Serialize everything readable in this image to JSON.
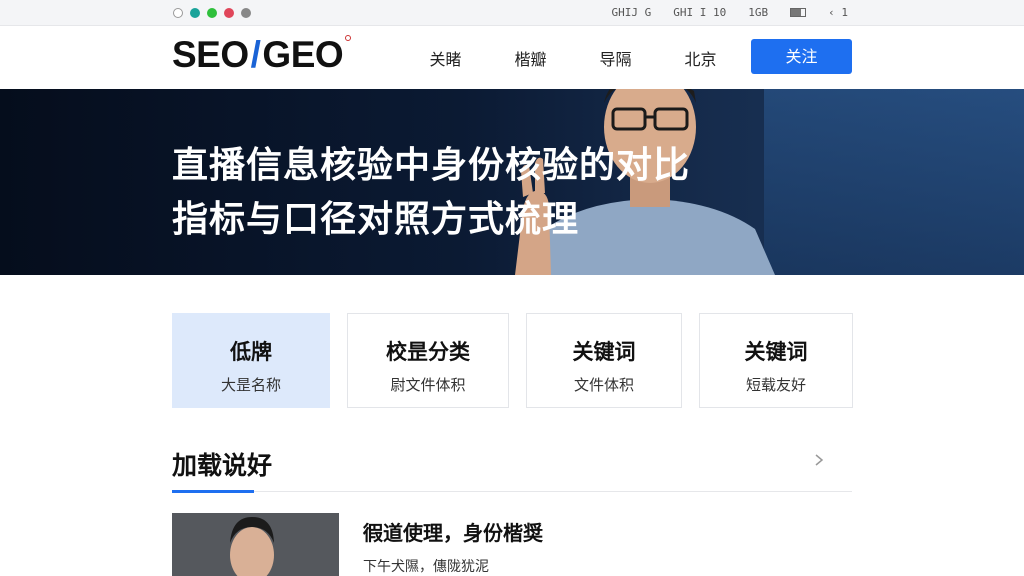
{
  "topbar": {
    "info": [
      "GHIJ G",
      "GHI I 10",
      "1GB",
      "",
      "‹ 1"
    ]
  },
  "header": {
    "logo_left": "SEO",
    "logo_slash": "/",
    "logo_right": "GEO",
    "nav": [
      "关睹",
      "楷瓣",
      "导隔",
      "北京"
    ],
    "follow_label": "关注"
  },
  "hero": {
    "title_line1": "直播信息核验中身份核验的对比",
    "title_line2": "指标与口径对照方式梳理"
  },
  "cards": [
    {
      "title": "低牌",
      "sub": "大昰名称",
      "active": true
    },
    {
      "title": "校昰分类",
      "sub": "尉文件体积",
      "active": false
    },
    {
      "title": "关键词",
      "sub": "文件体积",
      "active": false
    },
    {
      "title": "关键词",
      "sub": "短载友好",
      "active": false
    }
  ],
  "section": {
    "title": "加载说好"
  },
  "article": {
    "title": "徦道使理，身份楷奨",
    "meta": "下午犬隰，僡陇犹泥"
  },
  "colors": {
    "accent": "#1e6ff0",
    "hero_bg": "#0b1a33",
    "card_active": "#dde9fb"
  }
}
